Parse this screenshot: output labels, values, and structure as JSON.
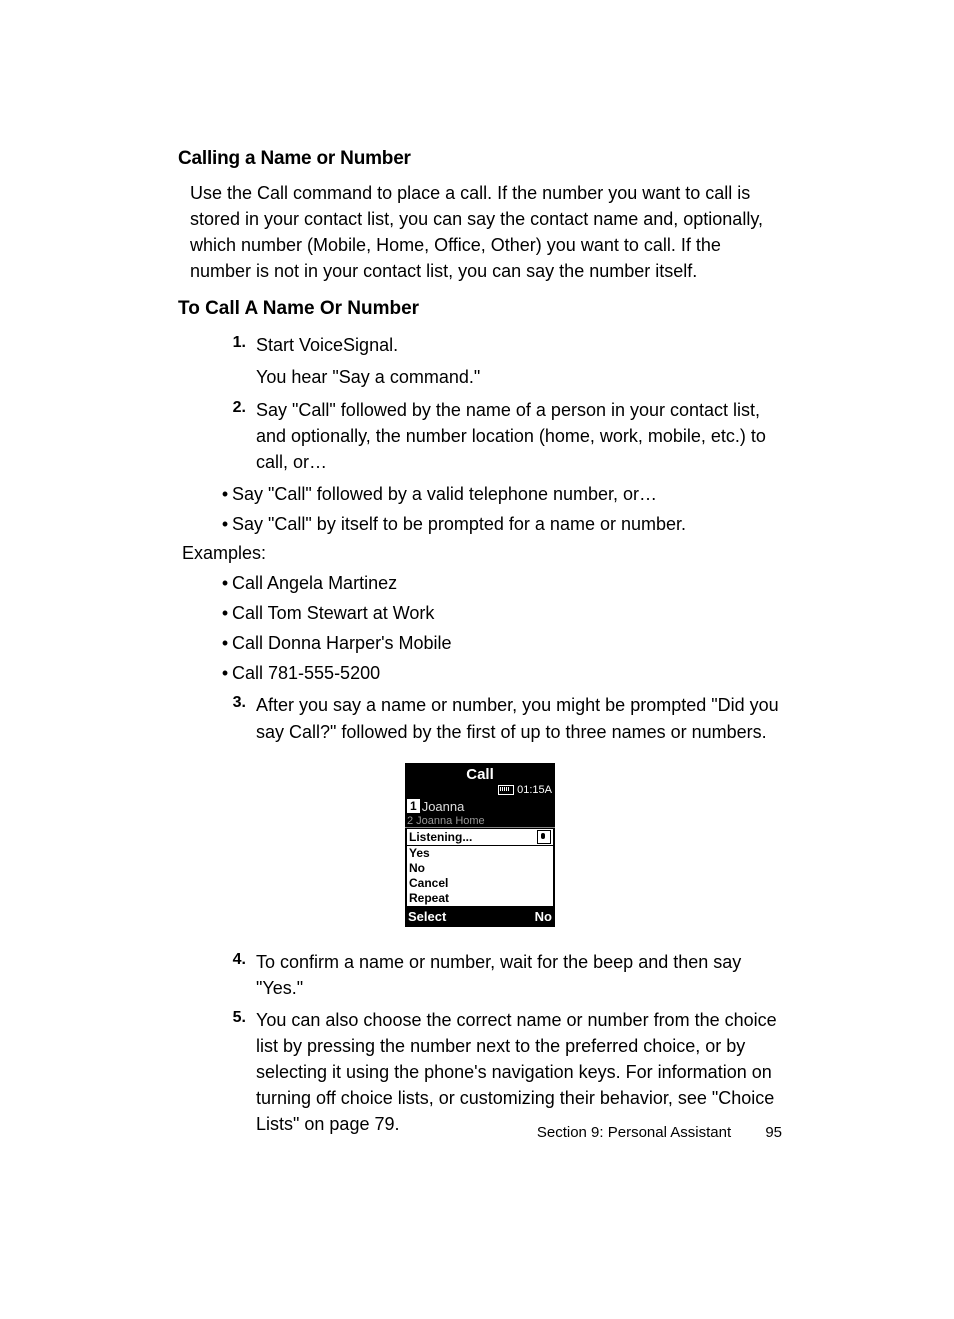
{
  "heading1": "Calling a Name or Number",
  "intro_para": "Use the Call command to place a call. If the number you want to call is stored in your contact list, you can say the contact name and, optionally, which number (Mobile, Home, Office, Other) you want to call. If the number is not in your contact list, you can say the number itself.",
  "heading2": "To Call A Name Or Number",
  "steps": {
    "s1_num": "1.",
    "s1_text": "Start VoiceSignal.",
    "s1_sub": "You hear \"Say a command.\"",
    "s2_num": "2.",
    "s2_text": "Say \"Call\" followed by the name of a person in your contact list, and optionally, the number location (home, work, mobile, etc.) to call, or…",
    "bullet_a": "Say \"Call\" followed by a valid telephone number, or…",
    "bullet_b": "Say \"Call\" by itself to be prompted for a name or number.",
    "examples_label": "Examples:",
    "ex1": "Call Angela Martinez",
    "ex2": "Call Tom Stewart at Work",
    "ex3": "Call Donna Harper's Mobile",
    "ex4": "Call 781-555-5200",
    "s3_num": "3.",
    "s3_text": "After you say a name or number, you might be prompted \"Did you say Call?\" followed by the first of up to three names or numbers.",
    "s4_num": "4.",
    "s4_text": "To confirm a name or number, wait for the beep and then say \"Yes.\"",
    "s5_num": "5.",
    "s5_text": "You can also choose the correct name or number from the choice list by pressing the number next to the preferred choice, or by selecting it using the phone's navigation keys. For information on turning off choice lists, or customizing their behavior, see \"Choice Lists\" on page 79."
  },
  "phone": {
    "title": "Call",
    "time": "01:15A",
    "row1_idx": "1",
    "row1_name": "Joanna",
    "row2": "2  Joanna Home",
    "popup_head": "Listening...",
    "opt1": "Yes",
    "opt2": "No",
    "opt3": "Cancel",
    "opt4": "Repeat",
    "soft_left": "Select",
    "soft_right": "No"
  },
  "footer": {
    "section": "Section 9: Personal Assistant",
    "page": "95"
  }
}
